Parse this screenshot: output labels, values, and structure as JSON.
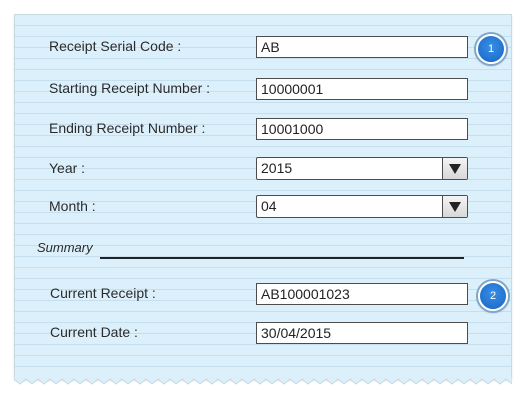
{
  "form": {
    "serial_code": {
      "label": "Receipt Serial Code :",
      "value": "AB"
    },
    "starting_number": {
      "label": "Starting Receipt Number :",
      "value": "10000001"
    },
    "ending_number": {
      "label": "Ending Receipt Number :",
      "value": "10001000"
    },
    "year": {
      "label": "Year :",
      "value": "2015"
    },
    "month": {
      "label": "Month :",
      "value": "04"
    }
  },
  "summary": {
    "heading": "Summary",
    "current_receipt": {
      "label": "Current Receipt :",
      "value": "AB100001023"
    },
    "current_date": {
      "label": "Current Date :",
      "value": "30/04/2015"
    }
  },
  "badges": [
    "1",
    "2"
  ],
  "colors": {
    "panel_background": "#dcf0fc",
    "badge_blue": "#1f73d1",
    "field_border": "#4d4d4d"
  },
  "icons": {
    "dropdown": "triangle-down-icon"
  }
}
